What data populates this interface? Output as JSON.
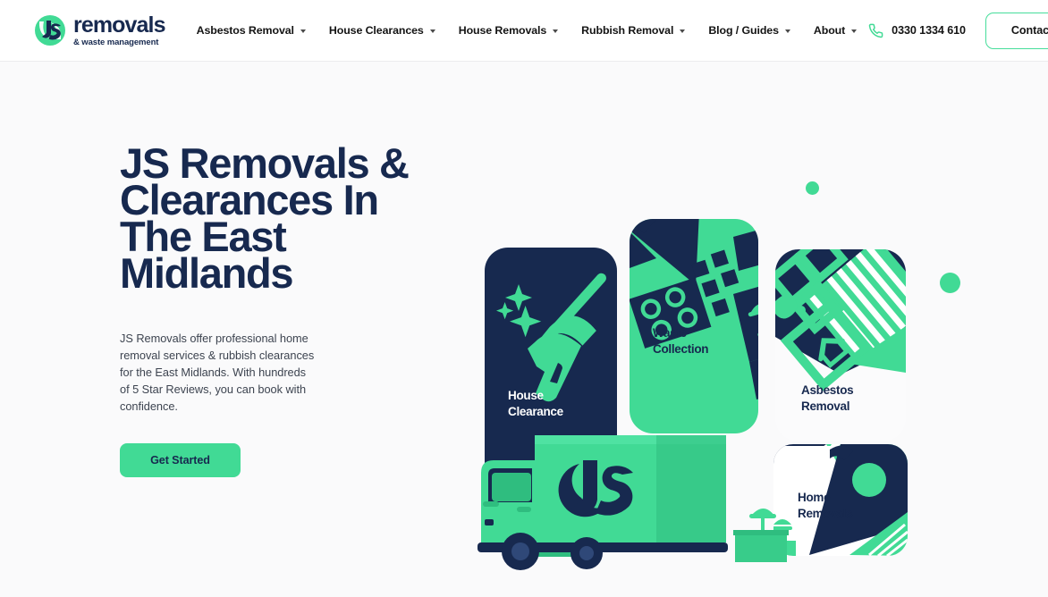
{
  "theme": {
    "green": "#41da95",
    "navy": "#17294f",
    "page_bg": "#fafafb",
    "header_bg": "#ffffff",
    "body_text": "#3d4450"
  },
  "header": {
    "logo": {
      "mark_icon": "js-monogram-icon",
      "word": "removals",
      "subtitle": "& waste management"
    },
    "nav": [
      {
        "label": "Asbestos Removal",
        "has_dropdown": true
      },
      {
        "label": "House Clearances",
        "has_dropdown": true
      },
      {
        "label": "House Removals",
        "has_dropdown": true
      },
      {
        "label": "Rubbish Removal",
        "has_dropdown": true
      },
      {
        "label": "Blog / Guides",
        "has_dropdown": true
      },
      {
        "label": "About",
        "has_dropdown": true
      }
    ],
    "phone": {
      "icon": "phone-icon",
      "number": "0330 1334 610"
    },
    "contact_button": "Contact Us"
  },
  "hero": {
    "title": "JS Removals & Clearances In The East Midlands",
    "paragraph": "JS Removals offer professional home removal services & rubbish clearances for the East Midlands. With hundreds of 5 Star Reviews, you can book with confidence.",
    "cta_label": "Get Started"
  },
  "illustration": {
    "cards": [
      {
        "id": "house-clearance",
        "label_line1": "House",
        "label_line2": "Clearance",
        "bg": "#17294f",
        "text_color": "#ffffff",
        "icon": "broom-sparkles-icon"
      },
      {
        "id": "waste-collection",
        "label_line1": "Waste",
        "label_line2": "Collection",
        "bg": "#41da95",
        "text_color": "#17294f",
        "icon": "household-items-icon"
      },
      {
        "id": "asbestos-removal",
        "label_line1": "Asbestos",
        "label_line2": "Removal",
        "bg": "#fbfbfc",
        "text_color": "#17294f",
        "icon": "roof-tiles-icon"
      },
      {
        "id": "home-removals",
        "label_line1": "Home",
        "label_line2": "Removals",
        "bg": "#ffffff",
        "text_color": "#17294f",
        "icon": "moving-shapes-icon"
      }
    ],
    "truck": {
      "id": "js-removals-truck",
      "badge": "JS"
    },
    "decor_dots": [
      {
        "id": "dot-small",
        "size": 15
      },
      {
        "id": "dot-large",
        "size": 23
      }
    ]
  }
}
